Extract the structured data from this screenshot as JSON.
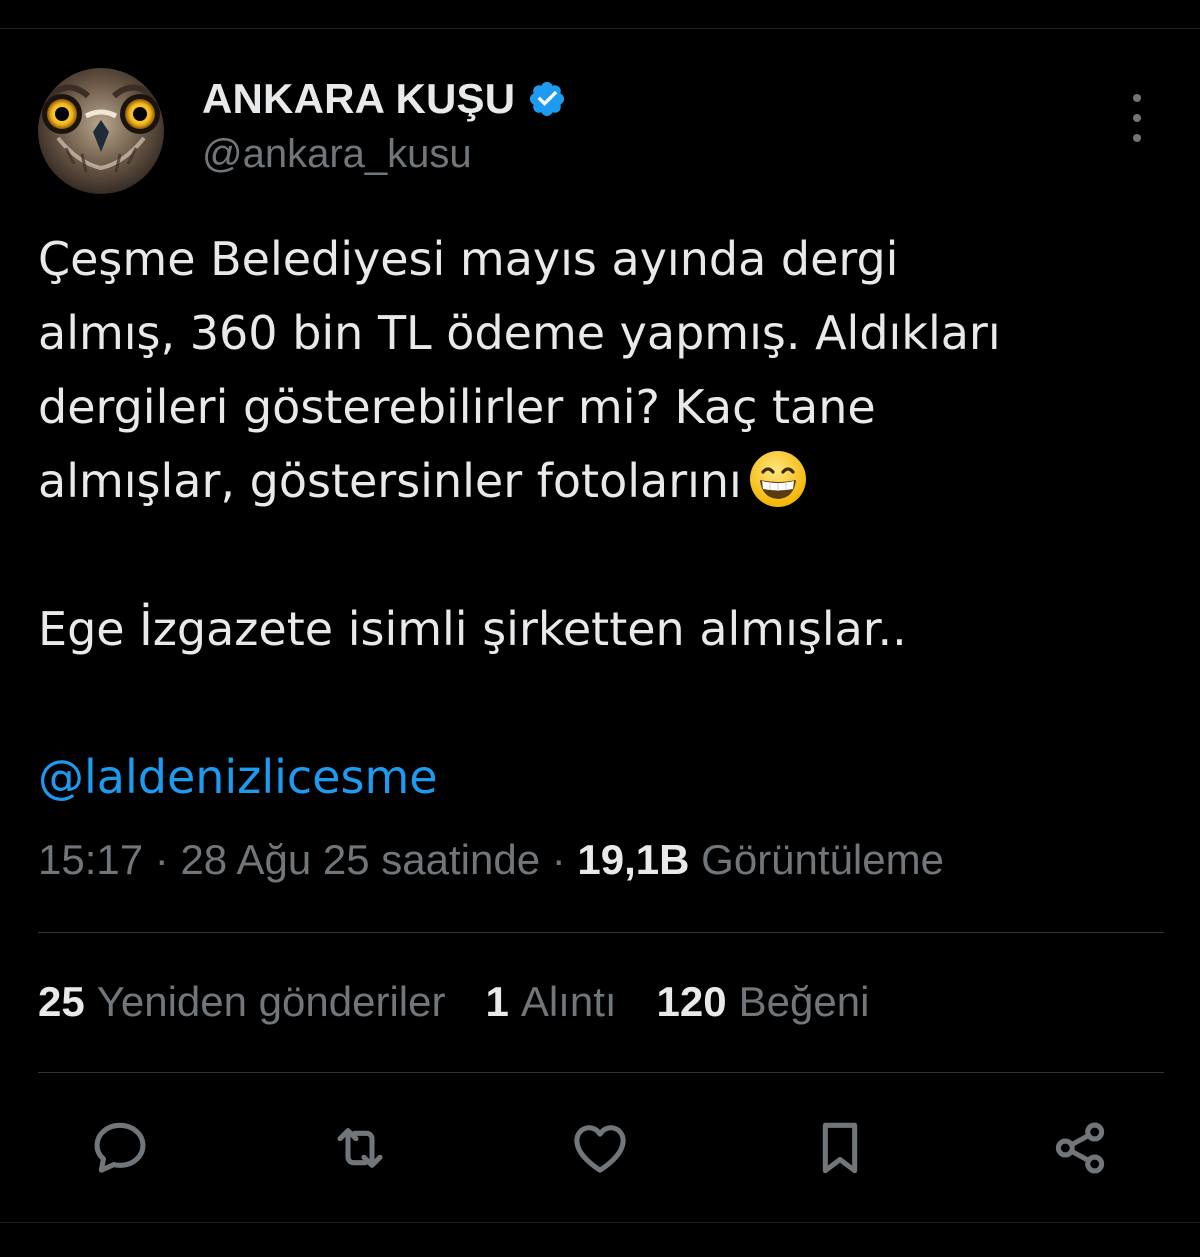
{
  "author": {
    "display_name": "ANKARA KUŞU",
    "handle": "@ankara_kusu",
    "verified": true,
    "avatar_icon": "owl-avatar"
  },
  "tweet": {
    "line1": "Çeşme Belediyesi mayıs ayında dergi",
    "line2": "almış, 360 bin TL ödeme yapmış. Aldıkları",
    "line3": "dergileri gösterebilirler mi? Kaç tane",
    "line4": "almışlar, göstersinler fotolarını",
    "emoji": "grinning-face-emoji",
    "line5": "Ege İzgazete isimli şirketten almışlar..",
    "mention": "@laldenizlicesme"
  },
  "meta": {
    "time": "15:17",
    "separator": " · ",
    "date": "28 Ağu 25 saatinde",
    "views_count": "19,1B",
    "views_label": "Görüntüleme"
  },
  "stats": {
    "reposts_count": "25",
    "reposts_label": "Yeniden gönderiler",
    "quotes_count": "1",
    "quotes_label": "Alıntı",
    "likes_count": "120",
    "likes_label": "Beğeni"
  },
  "actions": [
    "reply-icon",
    "repost-icon",
    "like-icon",
    "bookmark-icon",
    "share-icon"
  ],
  "colors": {
    "background": "#000000",
    "text": "#e7e9ea",
    "secondary": "#71767b",
    "accent": "#1d9bf0",
    "divider": "#2f3336"
  }
}
